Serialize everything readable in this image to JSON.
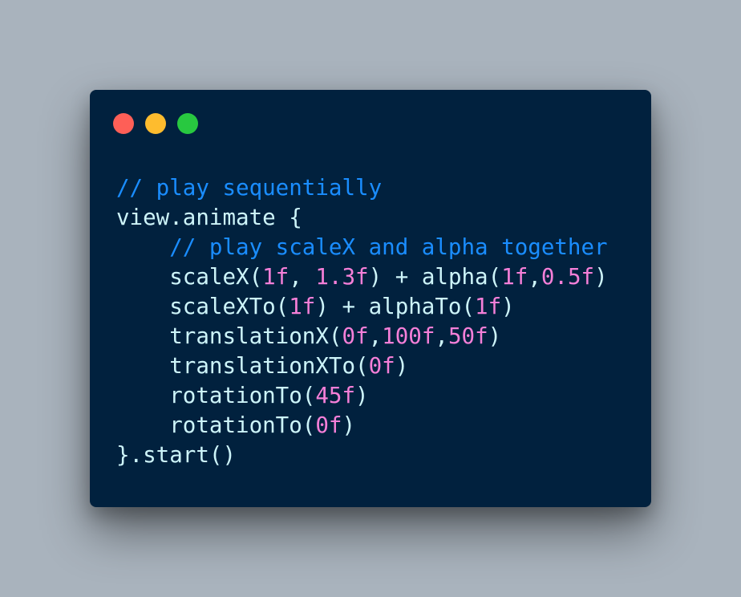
{
  "window": {
    "controls": [
      {
        "name": "close-control",
        "color": "#fe5f57"
      },
      {
        "name": "minimize-control",
        "color": "#febc2e"
      },
      {
        "name": "zoom-control",
        "color": "#28c840"
      }
    ]
  },
  "theme": {
    "background": "#01213e",
    "text": "#cdf4f9",
    "comment": "#1a8dff",
    "number": "#f57fd8"
  },
  "code": {
    "lines": [
      [
        {
          "t": "comment",
          "v": "// play sequentially"
        }
      ],
      [
        {
          "t": "plain",
          "v": "view.animate {"
        }
      ],
      [
        {
          "t": "plain",
          "v": "    "
        },
        {
          "t": "comment",
          "v": "// play scaleX and alpha together"
        }
      ],
      [
        {
          "t": "plain",
          "v": "    scaleX("
        },
        {
          "t": "num",
          "v": "1f"
        },
        {
          "t": "plain",
          "v": ", "
        },
        {
          "t": "num",
          "v": "1.3f"
        },
        {
          "t": "plain",
          "v": ") + alpha("
        },
        {
          "t": "num",
          "v": "1f"
        },
        {
          "t": "plain",
          "v": ","
        },
        {
          "t": "num",
          "v": "0.5f"
        },
        {
          "t": "plain",
          "v": ")"
        }
      ],
      [
        {
          "t": "plain",
          "v": "    scaleXTo("
        },
        {
          "t": "num",
          "v": "1f"
        },
        {
          "t": "plain",
          "v": ") + alphaTo("
        },
        {
          "t": "num",
          "v": "1f"
        },
        {
          "t": "plain",
          "v": ")"
        }
      ],
      [
        {
          "t": "plain",
          "v": "    translationX("
        },
        {
          "t": "num",
          "v": "0f"
        },
        {
          "t": "plain",
          "v": ","
        },
        {
          "t": "num",
          "v": "100f"
        },
        {
          "t": "plain",
          "v": ","
        },
        {
          "t": "num",
          "v": "50f"
        },
        {
          "t": "plain",
          "v": ")"
        }
      ],
      [
        {
          "t": "plain",
          "v": "    translationXTo("
        },
        {
          "t": "num",
          "v": "0f"
        },
        {
          "t": "plain",
          "v": ")"
        }
      ],
      [
        {
          "t": "plain",
          "v": "    rotationTo("
        },
        {
          "t": "num",
          "v": "45f"
        },
        {
          "t": "plain",
          "v": ")"
        }
      ],
      [
        {
          "t": "plain",
          "v": "    rotationTo("
        },
        {
          "t": "num",
          "v": "0f"
        },
        {
          "t": "plain",
          "v": ")"
        }
      ],
      [
        {
          "t": "plain",
          "v": "}.start()"
        }
      ]
    ]
  }
}
